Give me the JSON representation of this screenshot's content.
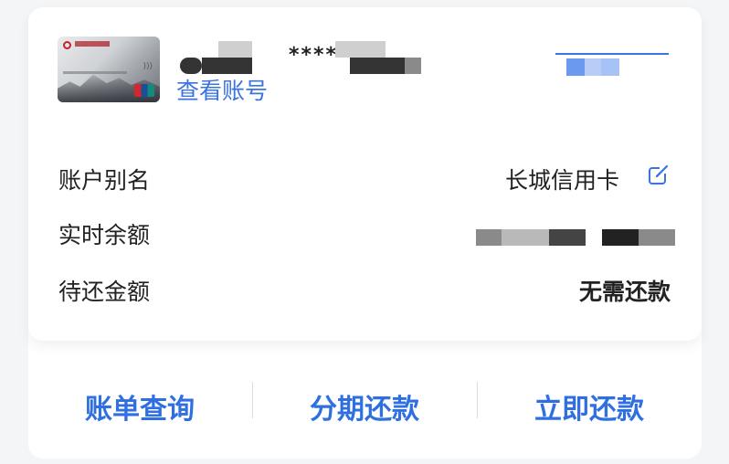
{
  "account": {
    "masked_prefix": "****",
    "view_account_link": "查看账号"
  },
  "rows": {
    "alias": {
      "label": "账户别名",
      "value": "长城信用卡"
    },
    "balance": {
      "label": "实时余额"
    },
    "due": {
      "label": "待还金额",
      "value": "无需还款"
    }
  },
  "actions": {
    "bill": "账单查询",
    "installment": "分期还款",
    "repay": "立即还款"
  },
  "colors": {
    "accent": "#2f6fe0",
    "link": "#3a74e0"
  },
  "icons": {
    "edit": "edit-icon"
  }
}
